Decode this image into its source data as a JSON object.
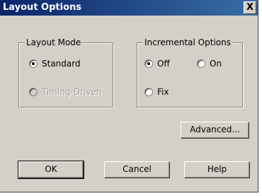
{
  "window": {
    "title": "Layout Options",
    "close_label": "X"
  },
  "layout_mode": {
    "legend": "Layout Mode",
    "options": [
      {
        "label": "Standard",
        "checked": true,
        "enabled": true
      },
      {
        "label": "Timing-Driven",
        "checked": false,
        "enabled": false
      }
    ]
  },
  "incremental": {
    "legend": "Incremental Options",
    "options": [
      {
        "label": "Off",
        "checked": true
      },
      {
        "label": "On",
        "checked": false
      },
      {
        "label": "Fix",
        "checked": false
      }
    ]
  },
  "buttons": {
    "advanced": "Advanced...",
    "ok": "OK",
    "cancel": "Cancel",
    "help": "Help"
  }
}
